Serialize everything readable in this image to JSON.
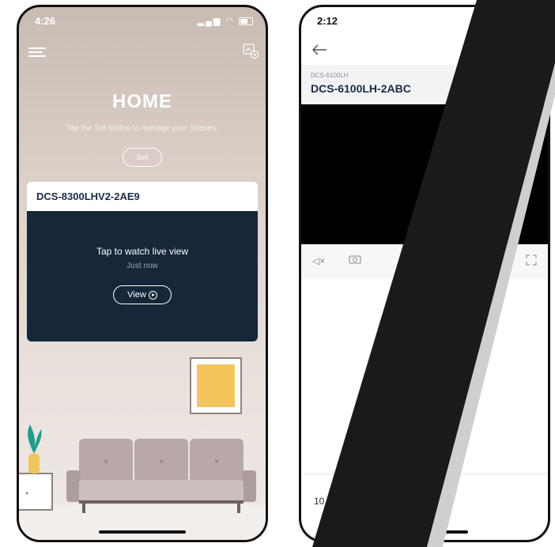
{
  "left_phone": {
    "time": "4:26",
    "home_title": "HOME",
    "subtitle": "Tap the Set button to manage your Scenes.",
    "set_label": "Set",
    "camera_card": {
      "name": "DCS-8300LHV2-2AE9",
      "watch_text": "Tap to watch live view",
      "last_seen": "Just now",
      "view_label": "View"
    }
  },
  "right_phone": {
    "time": "2:12",
    "model": "DCS-6100LH",
    "device_name": "DCS-6100LH-2ABC",
    "date_fragment": "10"
  },
  "icons": [
    "menu-icon",
    "scene-settings-icon",
    "back-arrow-icon",
    "mute-icon",
    "snapshot-camera-icon",
    "fullscreen-icon",
    "play-icon"
  ]
}
